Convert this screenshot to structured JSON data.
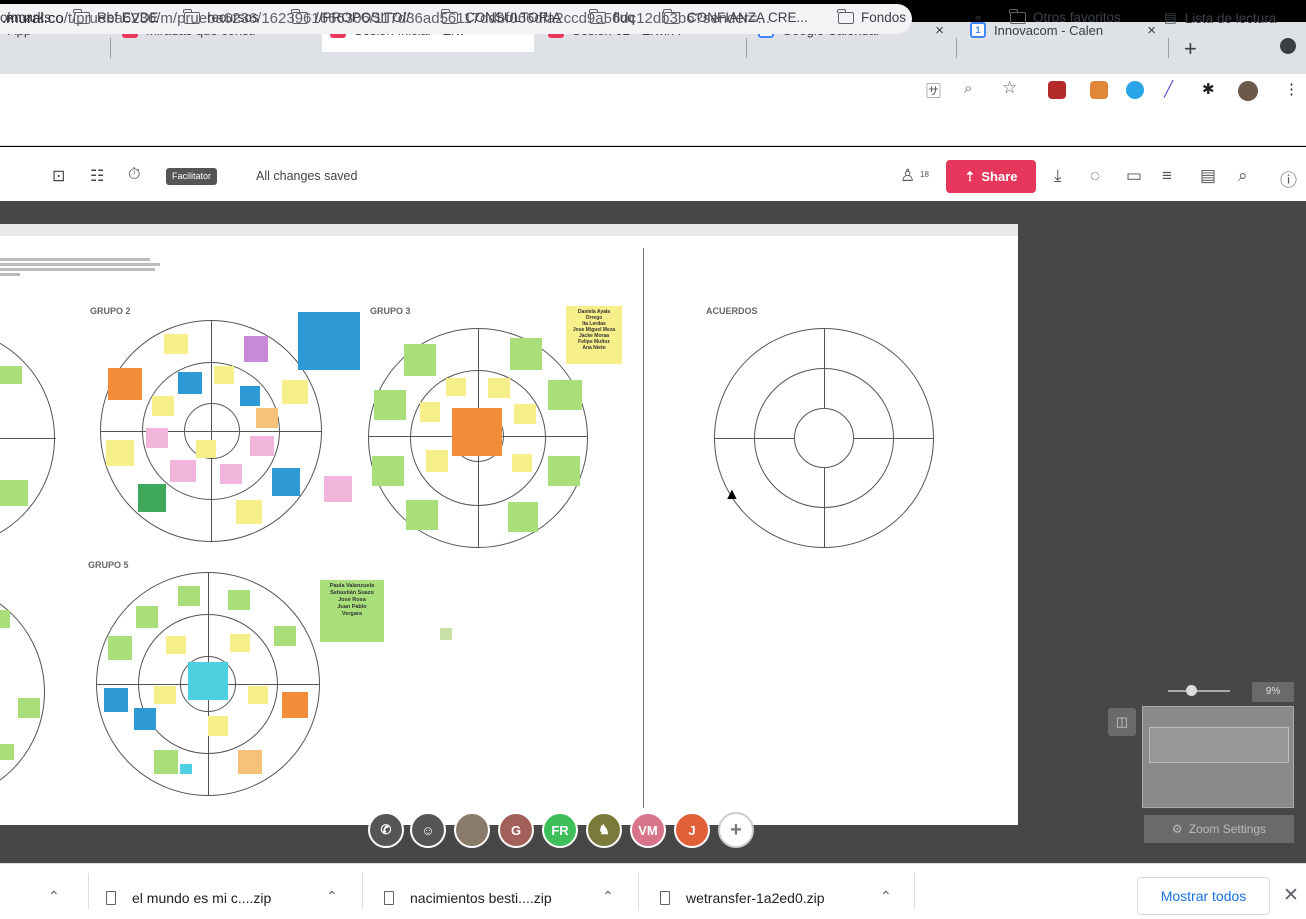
{
  "tabs": [
    {
      "label": "App",
      "active": false
    },
    {
      "label": "Miradas que constr",
      "active": false
    },
    {
      "label": "Sesión Inicial • Erw",
      "active": true
    },
    {
      "label": "Sesión 02 • Erwin F",
      "active": false
    },
    {
      "label": "Google Calendar -",
      "active": false
    },
    {
      "label": "Innovacom - Calen",
      "active": false
    }
  ],
  "address": {
    "host": ".mural.co",
    "path": "/t/prueba6236/m/prueba6236/1623961666306/117d36ad56117ddbf066dfa2ccd9a56dc12db3b6?sender=..."
  },
  "bookmarks": {
    "items": [
      "okmarks",
      "Ref EVDE",
      "recursos",
      "//PROPOSITO//",
      "CONSULTORIA",
      "fluq",
      "CONFIANZA CRE...",
      "Fondos"
    ],
    "more": "»",
    "others": "Otros favoritos",
    "reading": "Lista de lectura"
  },
  "mural_toolbar": {
    "facilitator": "Facilitator",
    "saved": "All changes saved",
    "members_count": "18",
    "share": "Share"
  },
  "board": {
    "groups": {
      "g2": "GRUPO 2",
      "g3": "GRUPO 3",
      "g5": "GRUPO 5",
      "agreements": "ACUERDOS"
    },
    "g5_names": [
      "Paula Valenzuela",
      "Sebastián Suazo",
      "José Rosa",
      "Juan Pablo",
      "Vergara"
    ],
    "g3_names": [
      "Daniela Ayala",
      "Orrego",
      "Ita Lerdas",
      "Jose Miguel Meza",
      "Jacke Moraa",
      "Felipe Muñoz",
      "Ana Nieto"
    ]
  },
  "zoom": {
    "percent": "9%",
    "settings": "Zoom Settings"
  },
  "participants": [
    {
      "initials": "G",
      "color": "#a1605a"
    },
    {
      "initials": "FR",
      "color": "#3fbf5a"
    },
    {
      "initials": "",
      "color": "#7a7a3a"
    },
    {
      "initials": "VM",
      "color": "#d9758a"
    },
    {
      "initials": "J",
      "color": "#e0603a"
    }
  ],
  "downloads": {
    "items": [
      "el mundo es mi c....zip",
      "nacimientos besti....zip",
      "wetransfer-1a2ed0.zip"
    ],
    "show_all": "Mostrar todos"
  },
  "colors": {
    "share": "#e8375c",
    "mural_brand": "#e8375c",
    "sticky_yellow": "#f7ef8a",
    "sticky_green": "#a8df7a",
    "sticky_blue": "#2d9ad6",
    "sticky_orange": "#f08c3a",
    "sticky_pink": "#f2b6dc"
  },
  "icons": {
    "tab_close": "×",
    "new_tab": "+",
    "star": "☆",
    "search": "⌕",
    "timer": "⏱",
    "share_up": "⇡",
    "chevron_up": "⌃",
    "close": "✕",
    "plus": "+",
    "phone": "✆",
    "cursor": "➤"
  }
}
